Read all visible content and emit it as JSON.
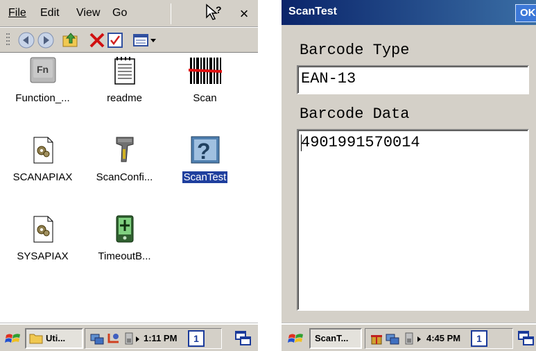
{
  "left": {
    "menubar": {
      "file": "File",
      "edit": "Edit",
      "view": "View",
      "go": "Go",
      "help_icon": "help-pointer-icon",
      "close": "×"
    },
    "toolbar": {
      "icons": [
        "back-icon",
        "forward-icon",
        "up-folder-icon",
        "delete-icon",
        "properties-icon",
        "view-menu-icon"
      ]
    },
    "files": [
      {
        "label": "Function_...",
        "icon": "fn-key-icon"
      },
      {
        "label": "readme",
        "icon": "text-document-icon"
      },
      {
        "label": "Scan",
        "icon": "barcode-icon"
      },
      {
        "label": "SCANAPIAX",
        "icon": "settings-file-icon"
      },
      {
        "label": "ScanConfi...",
        "icon": "scanner-gun-icon"
      },
      {
        "label": "ScanTest",
        "icon": "unknown-app-icon",
        "selected": true
      },
      {
        "label": "SYSAPIAX",
        "icon": "settings-file-icon"
      },
      {
        "label": "TimeoutB...",
        "icon": "battery-icon"
      }
    ],
    "taskbar": {
      "task": "Uti...",
      "time": "1:11 PM",
      "desk": "1"
    }
  },
  "right": {
    "title": "ScanTest",
    "ok": "OK",
    "barcode_type_label": "Barcode Type",
    "barcode_type_value": "EAN-13",
    "barcode_data_label": "Barcode Data",
    "barcode_data_value": "4901991570014",
    "taskbar": {
      "task": "ScanT...",
      "time": "4:45 PM",
      "desk": "1"
    }
  },
  "colors": {
    "titlebar": "#0a246a",
    "selection": "#1f3f9e",
    "chrome": "#d4d0c8"
  }
}
